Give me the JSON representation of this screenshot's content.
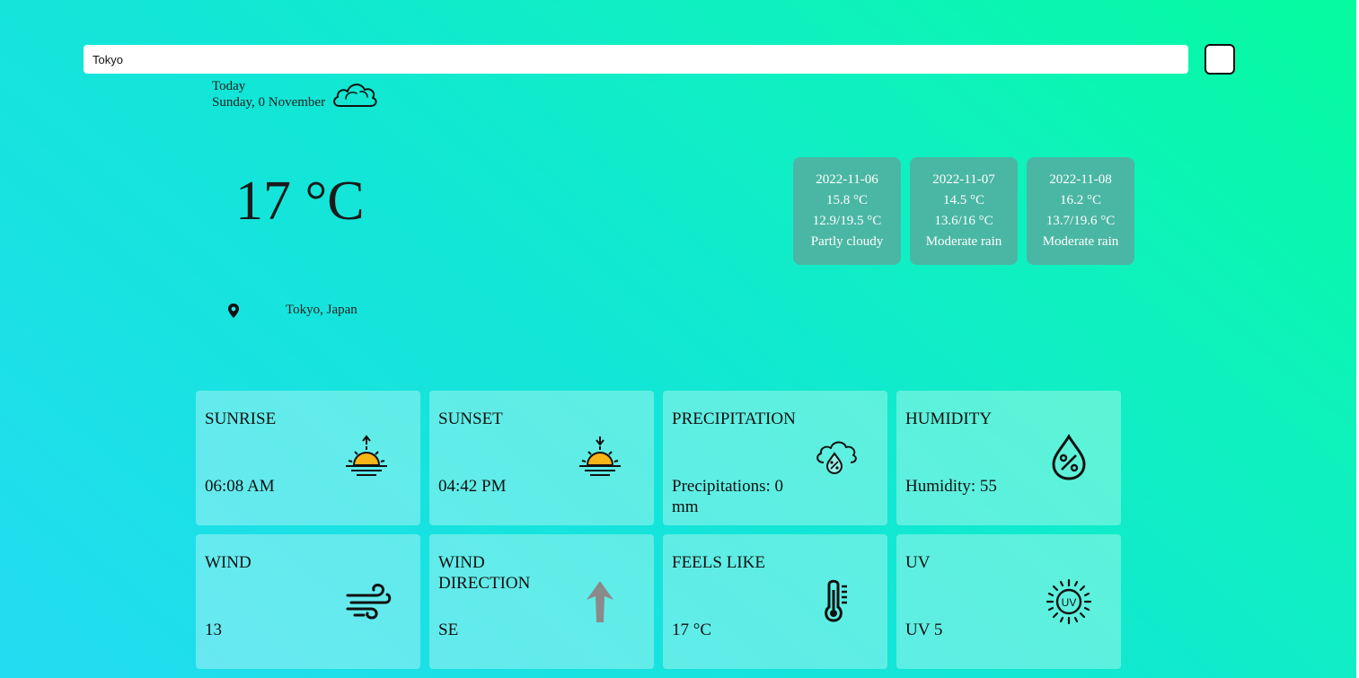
{
  "search": {
    "value": "Tokyo",
    "button_icon": "blank-square-icon"
  },
  "today": {
    "label": "Today",
    "date": "Sunday, 0 November",
    "icon": "cloud-icon",
    "temperature": "17 °C",
    "location": "Tokyo, Japan",
    "location_icon": "map-pin-icon"
  },
  "forecast": [
    {
      "date": "2022-11-06",
      "avg": "15.8 °C",
      "range": "12.9/19.5 °C",
      "condition": "Partly cloudy"
    },
    {
      "date": "2022-11-07",
      "avg": "14.5 °C",
      "range": "13.6/16 °C",
      "condition": "Moderate rain"
    },
    {
      "date": "2022-11-08",
      "avg": "16.2 °C",
      "range": "13.7/19.6 °C",
      "condition": "Moderate rain"
    }
  ],
  "tiles": {
    "sunrise": {
      "title": "SUNRISE",
      "value": "06:08 AM",
      "icon": "sunrise-icon"
    },
    "sunset": {
      "title": "SUNSET",
      "value": "04:42 PM",
      "icon": "sunset-icon"
    },
    "precipitation": {
      "title": "PRECIPITATION",
      "value": "Precipitations: 0 mm",
      "icon": "cloud-percent-icon"
    },
    "humidity": {
      "title": "HUMIDITY",
      "value": "Humidity: 55",
      "icon": "humidity-drop-icon"
    },
    "wind": {
      "title": "WIND",
      "value": "13",
      "icon": "wind-icon"
    },
    "wind_direction": {
      "title": "WIND DIRECTION",
      "value": "SE",
      "icon": "direction-arrow-icon"
    },
    "feels_like": {
      "title": "FEELS LIKE",
      "value": "17 °C",
      "icon": "thermometer-icon"
    },
    "uv": {
      "title": "UV",
      "value": "UV 5",
      "icon": "uv-sun-icon"
    }
  },
  "colors": {
    "background_start": "#23dcf2",
    "background_end": "#05fb9f",
    "forecast_card": "#4ab7a4",
    "sun_fill": "#f9b416",
    "arrow_gray": "#8a8a8a"
  }
}
